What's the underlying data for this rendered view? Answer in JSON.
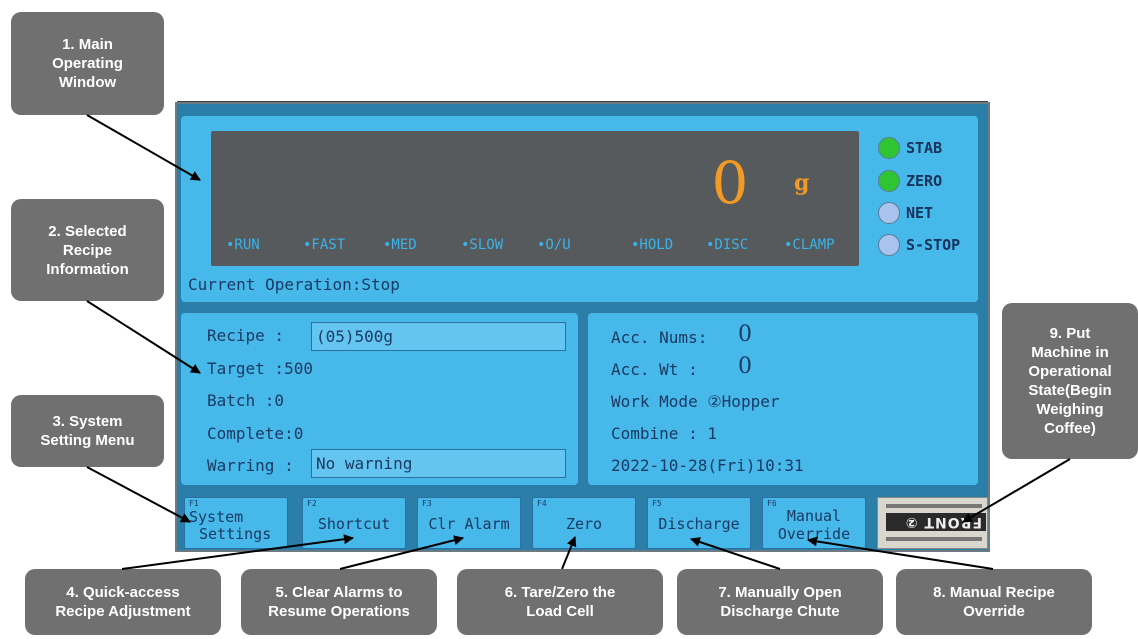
{
  "display": {
    "weight_value": "0",
    "unit": "g",
    "indicators": [
      "•RUN",
      "•FAST",
      "•MED",
      "•SLOW",
      "•O/U",
      "•HOLD",
      "•DISC",
      "•CLAMP"
    ],
    "current_operation": "Current Operation:Stop"
  },
  "status_leds": [
    {
      "label": "STAB",
      "color": "#2ec432"
    },
    {
      "label": "ZERO",
      "color": "#2ec432"
    },
    {
      "label": "NET",
      "color": "#a9c3ee"
    },
    {
      "label": "S-STOP",
      "color": "#a9c3ee"
    }
  ],
  "recipe_info": {
    "recipe_label": "Recipe  :",
    "recipe_value": "(05)500g",
    "target_label": "Target  :500",
    "batch_label": "Batch   :0",
    "complete_label": "Complete:0",
    "warning_label": "Warring :",
    "warning_value": "No warning"
  },
  "accumulation": {
    "acc_nums_label": "Acc. Nums:",
    "acc_nums_value": "0",
    "acc_wt_label": "Acc. Wt  :",
    "acc_wt_value": "0",
    "work_mode": "Work Mode  ②Hopper",
    "combine": "Combine : 1",
    "datetime": "2022-10-28(Fri)10:31"
  },
  "function_keys": [
    {
      "num": "F1",
      "line1": "System",
      "line2": "Settings"
    },
    {
      "num": "F2",
      "line1": "",
      "line2": "Shortcut"
    },
    {
      "num": "F3",
      "line1": "",
      "line2": "Clr Alarm"
    },
    {
      "num": "F4",
      "line1": "",
      "line2": "Zero"
    },
    {
      "num": "F5",
      "line1": "",
      "line2": "Discharge"
    },
    {
      "num": "F6",
      "line1": "Manual",
      "line2": "Override"
    }
  ],
  "sticker_text": "FRONT ②",
  "callouts": {
    "c1": "1. Main\nOperating\nWindow",
    "c2": "2. Selected\nRecipe\nInformation",
    "c3": "3. System\nSetting Menu",
    "c4": "4. Quick-access\nRecipe Adjustment",
    "c5": "5. Clear Alarms to\nResume Operations",
    "c6": "6. Tare/Zero the\nLoad Cell",
    "c7": "7. Manually Open\nDischarge Chute",
    "c8": "8. Manual Recipe\nOverride",
    "c9": "9. Put\nMachine in\nOperational\nState(Begin\nWeighing\nCoffee)"
  }
}
